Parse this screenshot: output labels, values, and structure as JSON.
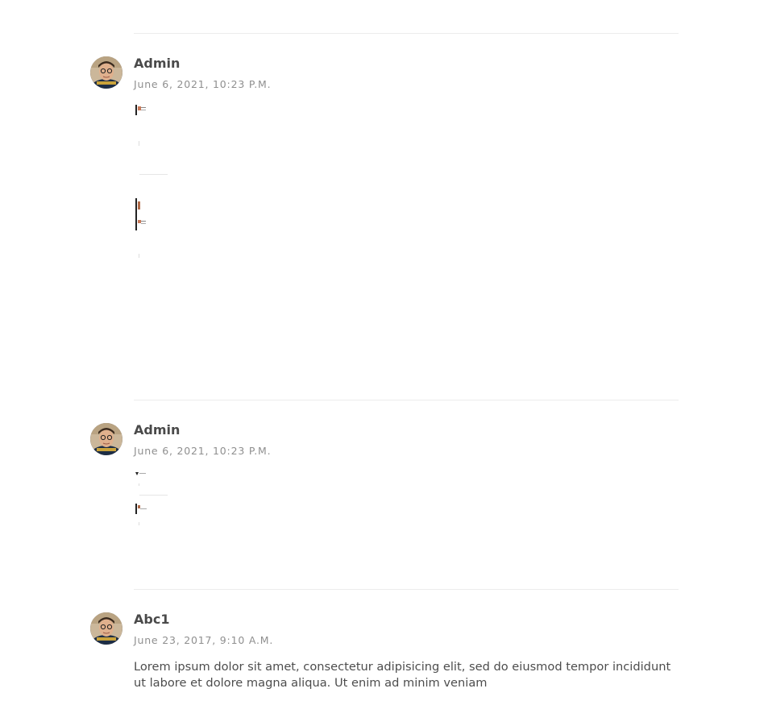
{
  "comments": [
    {
      "author": "Admin",
      "date": "June 6, 2021, 10:23 P.M.",
      "body": ""
    },
    {
      "author": "Admin",
      "date": "June 6, 2021, 10:23 P.M.",
      "body": ""
    },
    {
      "author": "Abc1",
      "date": "June 23, 2017, 9:10 A.M.",
      "body": "Lorem ipsum dolor sit amet, consectetur adipisicing elit, sed do eiusmod tempor incididunt ut labore et dolore magna aliqua. Ut enim ad minim veniam"
    }
  ],
  "colors": {
    "divider": "#ececec",
    "author": "#4a4a4a",
    "date": "#8f8f8f",
    "body": "#4d4d4d"
  },
  "icons": {
    "avatar": "avatar-image",
    "broken_image": "embedded-image-fragment"
  }
}
